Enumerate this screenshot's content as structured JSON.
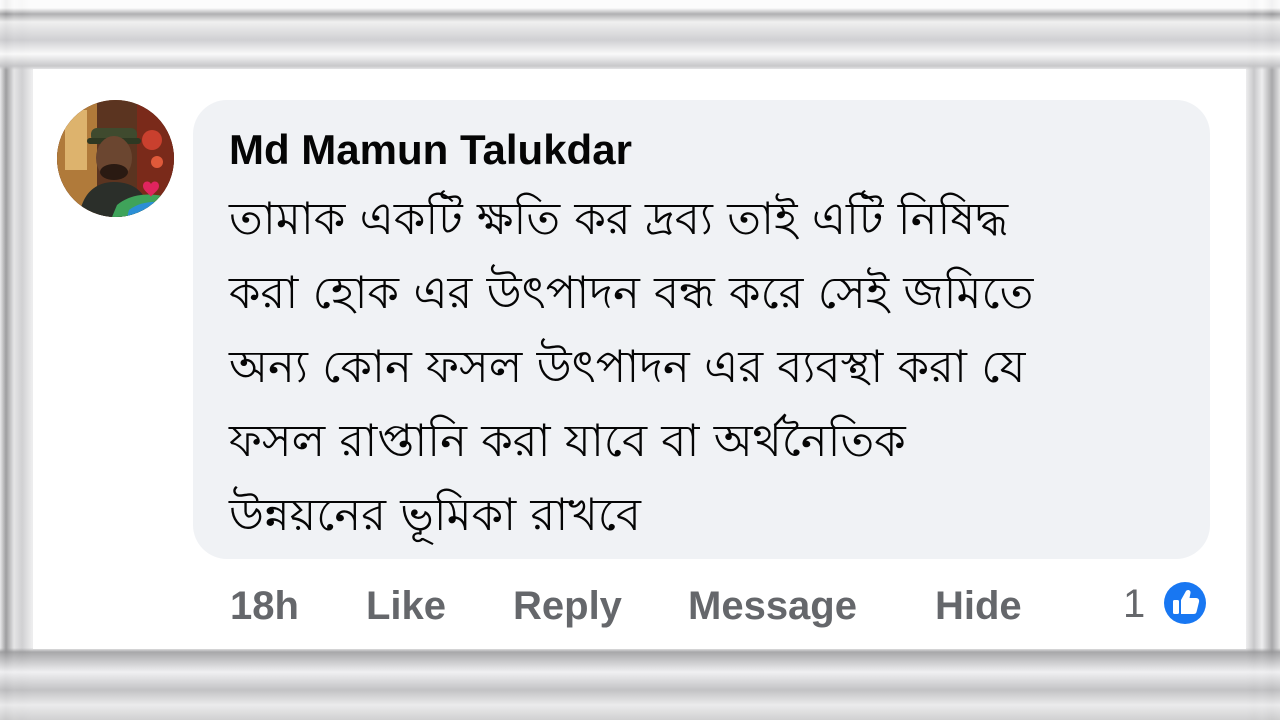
{
  "comment": {
    "author": "Md Mamun Talukdar",
    "text_lines": [
      "তামাক একটি ক্ষতি কর দ্রব্য তাই এটি নিষিদ্ধ",
      "করা হোক এর উৎপাদন বন্ধ করে সেই জমিতে",
      "অন্য কোন ফসল উৎপাদন এর ব্যবস্থা করা যে",
      "ফসল রাপ্তানি করা যাবে বা অর্থনৈতিক",
      "উন্নয়নের ভূমিকা রাখবে"
    ],
    "avatar_icon": "profile-photo"
  },
  "actions": {
    "time": "18h",
    "like_label": "Like",
    "reply_label": "Reply",
    "message_label": "Message",
    "hide_label": "Hide"
  },
  "reactions": {
    "count": "1",
    "icon": "like-thumbs-up-icon",
    "color": "#1877f2"
  },
  "colors": {
    "bubble": "#f0f2f5",
    "text": "#050505",
    "secondary_text": "#65676b"
  }
}
